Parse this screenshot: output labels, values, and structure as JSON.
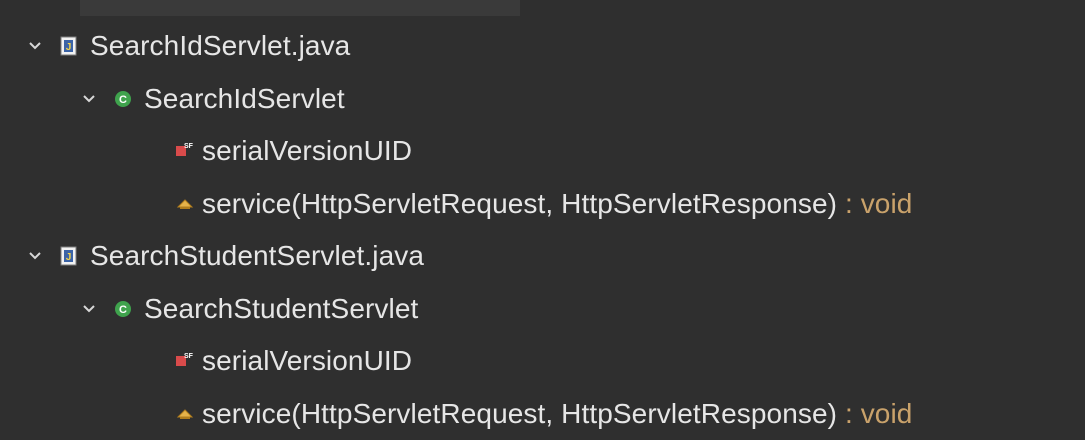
{
  "tree": {
    "files": [
      {
        "file_name": "SearchIdServlet.java",
        "class_name": "SearchIdServlet",
        "field_name": "serialVersionUID",
        "method_name": "service(HttpServletRequest, HttpServletResponse)",
        "method_type": ": void"
      },
      {
        "file_name": "SearchStudentServlet.java",
        "class_name": "SearchStudentServlet",
        "field_name": "serialVersionUID",
        "method_name": "service(HttpServletRequest, HttpServletResponse)",
        "method_type": ": void"
      }
    ]
  },
  "icons": {
    "expanded": "chevron-down-icon",
    "java_file": "java-file-icon",
    "class": "class-icon",
    "static_final_field": "static-final-field-icon",
    "protected_method": "protected-method-icon"
  },
  "colors": {
    "background": "#2f2f2f",
    "text": "#e6e6e6",
    "return_type": "#c9a26b",
    "class_icon": "#3fa34d",
    "field_icon": "#d94b4b",
    "method_icon": "#e6b34a"
  }
}
